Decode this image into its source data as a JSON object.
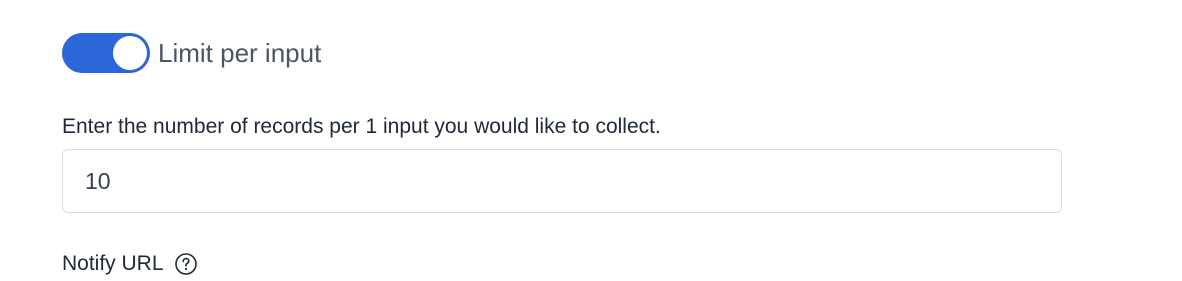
{
  "limit_toggle": {
    "label": "Limit per input",
    "checked": true,
    "color": "#2c66d9"
  },
  "records_field": {
    "label": "Enter the number of records per 1 input you would like to collect.",
    "value": "10"
  },
  "notify_url": {
    "label": "Notify URL",
    "help_icon": "question-circle-icon"
  }
}
